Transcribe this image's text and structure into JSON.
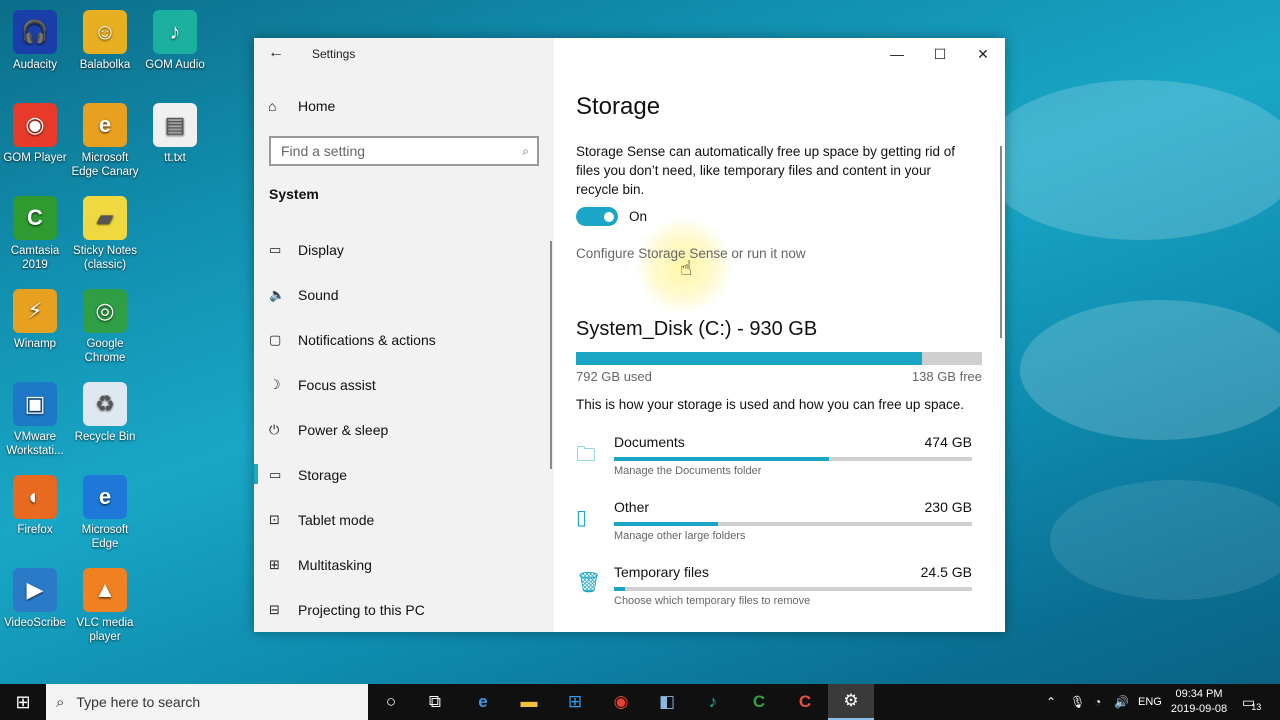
{
  "desktop": {
    "icons": [
      {
        "label": "Audacity",
        "icon": "audacity-icon",
        "color": "#1a3fa8"
      },
      {
        "label": "Balabolka",
        "icon": "balabolka-icon",
        "color": "#e8b020"
      },
      {
        "label": "GOM Audio",
        "icon": "gom-audio-icon",
        "color": "#1bb0a0"
      },
      {
        "label": "GOM Player",
        "icon": "gom-player-icon",
        "color": "#e83a2a"
      },
      {
        "label": "Microsoft Edge Canary",
        "icon": "edge-canary-icon",
        "color": "#e8a020"
      },
      {
        "label": "tt.txt",
        "icon": "text-file-icon",
        "color": "#f0f0f0"
      },
      {
        "label": "Camtasia 2019",
        "icon": "camtasia-icon",
        "color": "#2e9a30"
      },
      {
        "label": "Sticky Notes (classic)",
        "icon": "sticky-notes-icon",
        "color": "#f0d840"
      },
      {
        "label": "Winamp",
        "icon": "winamp-icon",
        "color": "#e8a020"
      },
      {
        "label": "Google Chrome",
        "icon": "chrome-icon",
        "color": "#2f9e44"
      },
      {
        "label": "VMware Workstati...",
        "icon": "vmware-icon",
        "color": "#1e78c8"
      },
      {
        "label": "Recycle Bin",
        "icon": "recycle-bin-icon",
        "color": "#dfe8f0"
      },
      {
        "label": "Firefox",
        "icon": "firefox-icon",
        "color": "#e86a20"
      },
      {
        "label": "Microsoft Edge",
        "icon": "edge-icon",
        "color": "#1e78d8"
      },
      {
        "label": "VideoScribe",
        "icon": "videoscribe-icon",
        "color": "#2a7ac8"
      },
      {
        "label": "VLC media player",
        "icon": "vlc-icon",
        "color": "#f08020"
      }
    ]
  },
  "window": {
    "title": "Settings",
    "controls": {
      "minimize": "—",
      "maximize": "☐",
      "close": "✕"
    }
  },
  "sidebar": {
    "home": "Home",
    "search_placeholder": "Find a setting",
    "section": "System",
    "items": [
      {
        "label": "Display",
        "icon": "display-icon",
        "glyph": "▭"
      },
      {
        "label": "Sound",
        "icon": "sound-icon",
        "glyph": "🔈"
      },
      {
        "label": "Notifications & actions",
        "icon": "notifications-icon",
        "glyph": "▢"
      },
      {
        "label": "Focus assist",
        "icon": "focus-assist-icon",
        "glyph": "☽"
      },
      {
        "label": "Power & sleep",
        "icon": "power-icon",
        "glyph": "⏻"
      },
      {
        "label": "Storage",
        "icon": "storage-icon",
        "glyph": "▭",
        "active": true
      },
      {
        "label": "Tablet mode",
        "icon": "tablet-mode-icon",
        "glyph": "⊡"
      },
      {
        "label": "Multitasking",
        "icon": "multitasking-icon",
        "glyph": "⊞"
      },
      {
        "label": "Projecting to this PC",
        "icon": "projecting-icon",
        "glyph": "⊟"
      }
    ]
  },
  "storage": {
    "title": "Storage",
    "description": "Storage Sense can automatically free up space by getting rid of files you don’t need, like temporary files and content in your recycle bin.",
    "toggle_state": "On",
    "toggle_on": true,
    "configure_link": "Configure Storage Sense or run it now",
    "disk_title": "System_Disk (C:) - 930 GB",
    "used_label": "792 GB used",
    "free_label": "138 GB free",
    "used_fraction": 0.852,
    "how_text": "This is how your storage is used and how you can free up space.",
    "categories": [
      {
        "name": "Documents",
        "size": "474 GB",
        "sub": "Manage the Documents folder",
        "fraction": 0.6,
        "icon": "documents-folder-icon",
        "glyph": "🗀"
      },
      {
        "name": "Other",
        "size": "230 GB",
        "sub": "Manage other large folders",
        "fraction": 0.29,
        "icon": "other-icon",
        "glyph": "▯"
      },
      {
        "name": "Temporary files",
        "size": "24.5 GB",
        "sub": "Choose which temporary files to remove",
        "fraction": 0.03,
        "icon": "trash-icon",
        "glyph": "🗑"
      }
    ],
    "accent": "#1aa7c7"
  },
  "taskbar": {
    "search_placeholder": "Type here to search",
    "language": "ENG",
    "time": "09:34 PM",
    "date": "2019-09-08",
    "notification_count": "13"
  }
}
